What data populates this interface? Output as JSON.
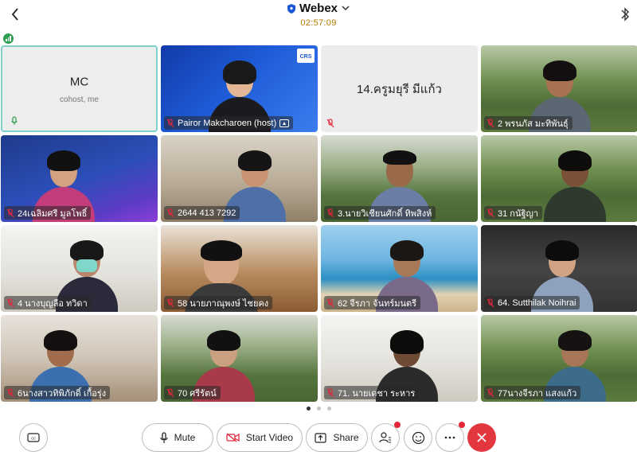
{
  "header": {
    "app_name": "Webex",
    "timer": "02:57:09"
  },
  "tiles": [
    {
      "name": "MC",
      "sub": "cohost, me"
    },
    {
      "name": "Pairor Makcharoen (host)",
      "badge": "CRS"
    },
    {
      "name": "14.ครูมยุรี มีแก้ว"
    },
    {
      "name": "2 พรนภัส มะทิพันธุ์"
    },
    {
      "name": "24เฉลิมศรี มูลโพธิ์"
    },
    {
      "name": "2644 413 7292"
    },
    {
      "name": "3.นายวิเชียนศักดิ์ ทิพสิงห์"
    },
    {
      "name": "31 กนัฐิญา"
    },
    {
      "name": "4 นางบุญลือ ทวิดา"
    },
    {
      "name": "58 นายภาณุพงษ์ ไชยคง"
    },
    {
      "name": "62 จีรภา จันทร์มนตรี"
    },
    {
      "name": "64. Sutthilak Noihrai"
    },
    {
      "name": "6นางสาวทิพิภักดิ์ เกื้อรุ่ง"
    },
    {
      "name": "70 ศรีรัตน์"
    },
    {
      "name": "71. นายเดชา ระหาร"
    },
    {
      "name": "77นางจีรภา แสงแก้ว"
    }
  ],
  "pager": {
    "pages": 3,
    "current": 1
  },
  "toolbar": {
    "mute_label": "Mute",
    "start_video_label": "Start Video",
    "share_label": "Share"
  },
  "colors": {
    "accent": "#7fd1cc",
    "timer": "#b57a00",
    "end_call": "#e2373f",
    "muted_mic": "#e2273a",
    "signal": "#2e9e4f"
  },
  "icons": [
    "back-chevron-icon",
    "shield-icon",
    "chevron-down-icon",
    "bluetooth-icon",
    "signal-icon",
    "mic-icon",
    "mic-muted-icon",
    "video-off-icon",
    "share-icon",
    "participants-icon",
    "emoji-icon",
    "more-icon",
    "close-icon",
    "closed-caption-icon"
  ]
}
